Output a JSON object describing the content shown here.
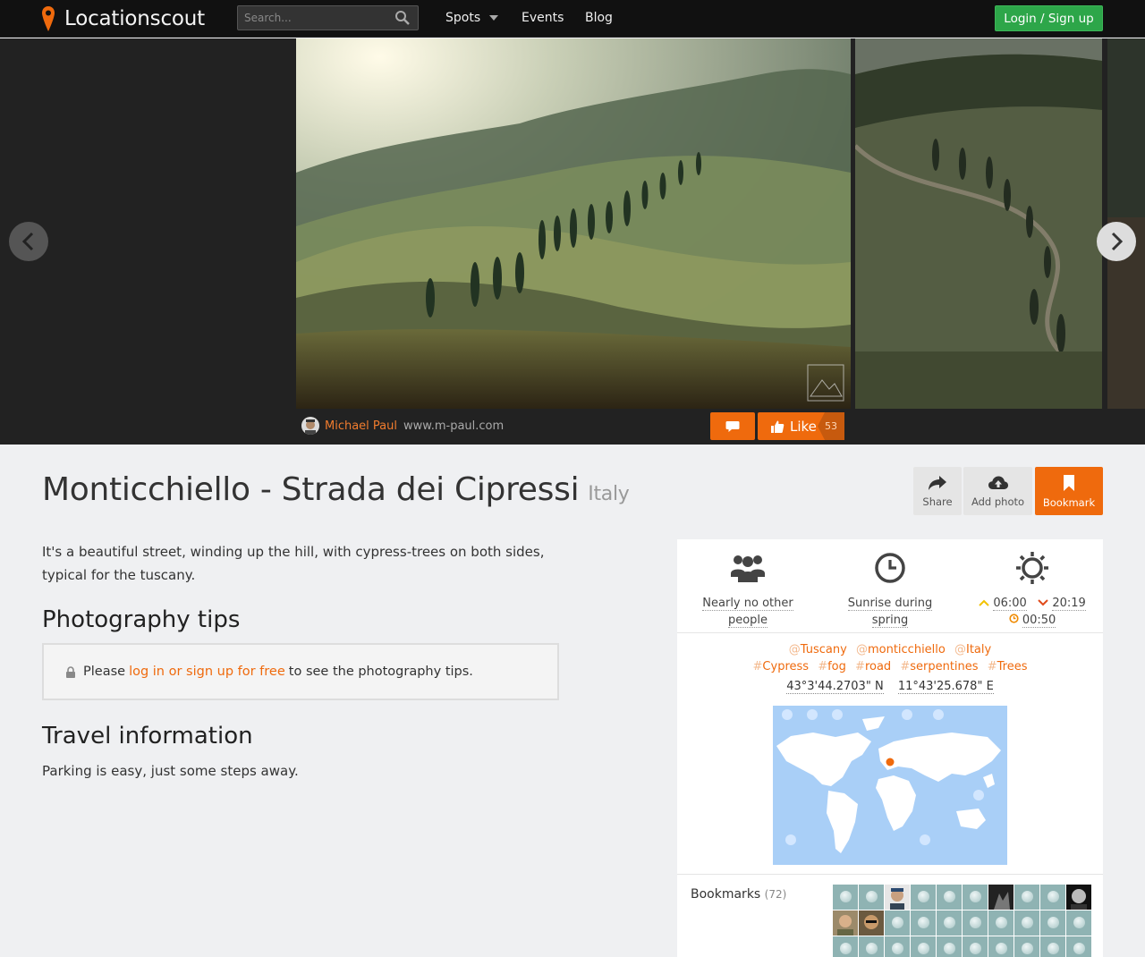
{
  "header": {
    "brand": "Locationscout",
    "search_placeholder": "Search...",
    "nav": {
      "spots": "Spots",
      "events": "Events",
      "blog": "Blog"
    },
    "login": "Login / Sign up"
  },
  "gallery": {
    "author": "Michael Paul",
    "website": "www.m-paul.com",
    "like_label": "Like",
    "like_count": "53"
  },
  "spot": {
    "title": "Monticchiello - Strada dei Cipressi",
    "country": "Italy",
    "description": "It's a beautiful street, winding up the hill, with cypress-trees on both sides, typical for the tuscany.",
    "tips_heading": "Photography tips",
    "tips_prefix": "Please",
    "tips_link": "log in or sign up for free",
    "tips_suffix": "to see the photography tips.",
    "travel_heading": "Travel information",
    "travel_text": "Parking is easy, just some steps away."
  },
  "actions": {
    "share": "Share",
    "add_photo": "Add photo",
    "bookmark": "Bookmark"
  },
  "stats": {
    "crowd": [
      "Nearly no other",
      "people"
    ],
    "time": [
      "Sunrise during",
      "spring"
    ],
    "sunrise": "06:00",
    "sunset": "20:19",
    "golden": "00:50"
  },
  "tags": {
    "places": [
      "Tuscany",
      "monticchiello",
      "Italy"
    ],
    "hashtags": [
      "Cypress",
      "fog",
      "road",
      "serpentines",
      "Trees"
    ]
  },
  "coords": {
    "lat": "43°3'44.2703\" N",
    "lng": "11°43'25.678\" E"
  },
  "bookmarks": {
    "label": "Bookmarks",
    "count": "(72)"
  },
  "colors": {
    "accent": "#ef6a0d",
    "login_green": "#2da649",
    "map_sea": "#a9cff7"
  }
}
